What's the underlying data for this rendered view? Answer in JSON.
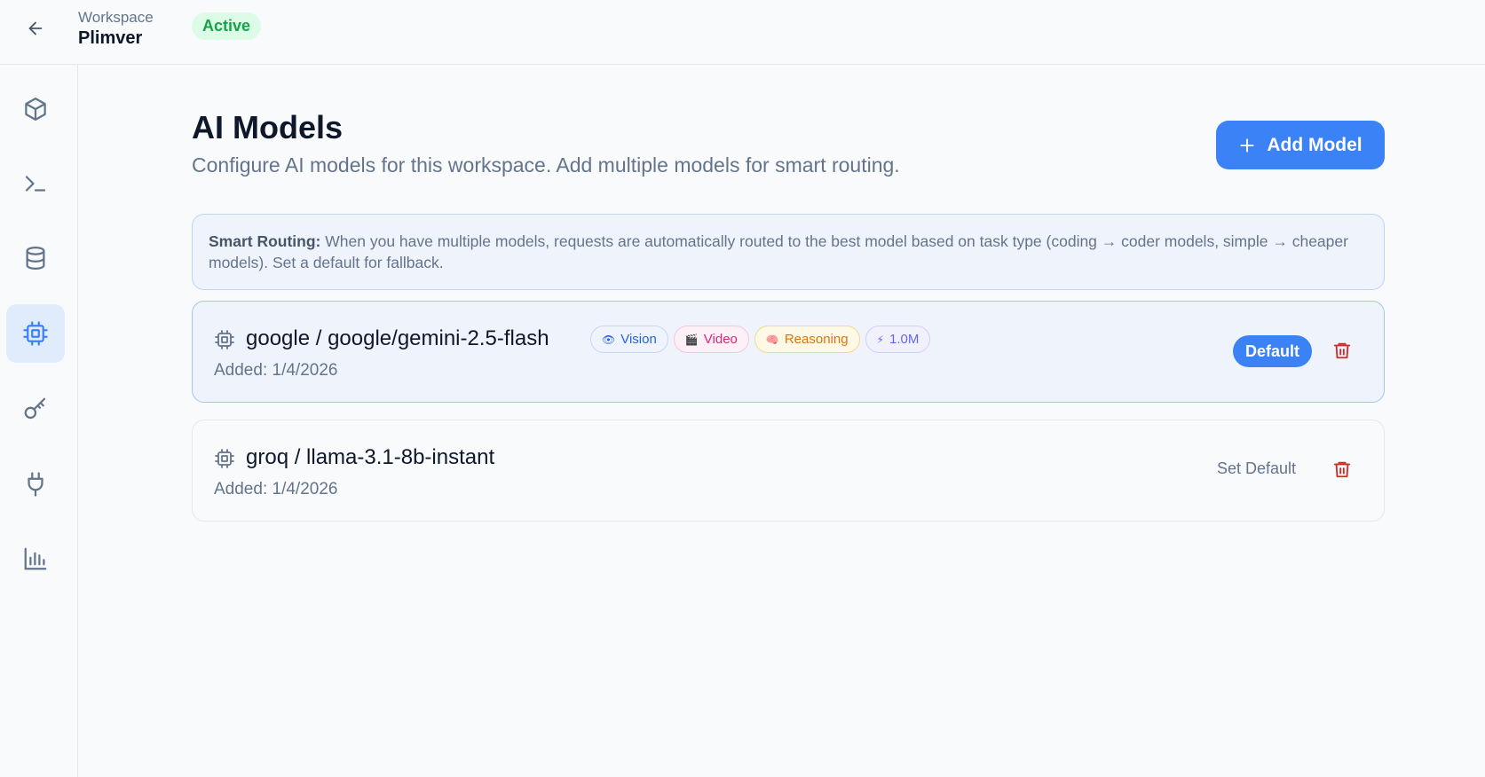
{
  "header": {
    "workspace_label": "Workspace",
    "workspace_name": "Plimver",
    "status": "Active"
  },
  "sidebar": {
    "items": [
      {
        "icon": "cube-icon",
        "active": false
      },
      {
        "icon": "terminal-icon",
        "active": false
      },
      {
        "icon": "database-icon",
        "active": false
      },
      {
        "icon": "cpu-chip-icon",
        "active": true
      },
      {
        "icon": "key-icon",
        "active": false
      },
      {
        "icon": "plug-icon",
        "active": false
      },
      {
        "icon": "bar-chart-icon",
        "active": false
      }
    ]
  },
  "page": {
    "title": "AI Models",
    "subtitle": "Configure AI models for this workspace. Add multiple models for smart routing.",
    "add_button_label": "Add Model"
  },
  "info": {
    "label": "Smart Routing:",
    "text": "When you have multiple models, requests are automatically routed to the best model based on task type (coding → coder models, simple → cheaper models). Set a default for fallback."
  },
  "models": [
    {
      "name": "google / google/gemini-2.5-flash",
      "added": "Added: 1/4/2026",
      "is_default": true,
      "action_label": "Default",
      "tags": [
        {
          "icon": "👁",
          "label": "Vision"
        },
        {
          "icon": "🎬",
          "label": "Video"
        },
        {
          "icon": "🧠",
          "label": "Reasoning"
        },
        {
          "icon": "⚡",
          "label": "1.0M"
        }
      ]
    },
    {
      "name": "groq / llama-3.1-8b-instant",
      "added": "Added: 1/4/2026",
      "is_default": false,
      "action_label": "Set Default",
      "tags": []
    }
  ],
  "colors": {
    "accent": "#3b82f6",
    "status_green": "#16a34a",
    "danger": "#dc2626",
    "active_nav_bg": "#e0ebfb"
  }
}
